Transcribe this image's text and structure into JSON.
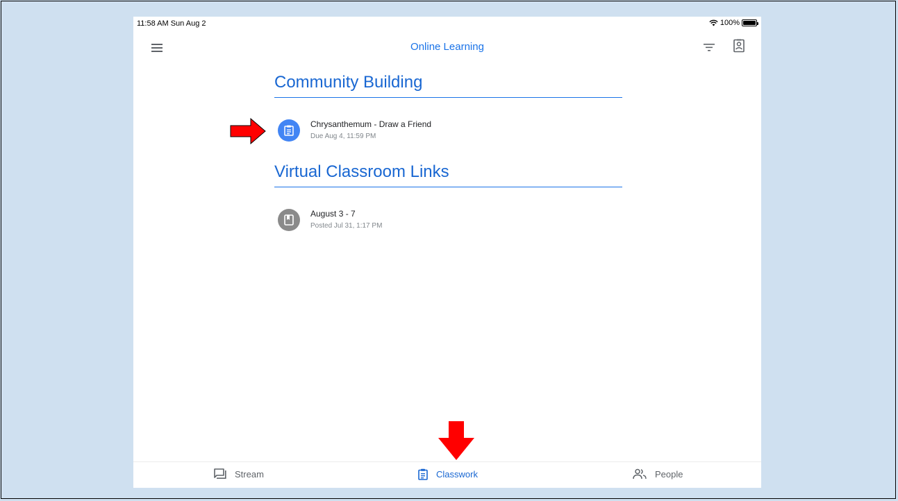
{
  "status_bar": {
    "time": "11:58 AM  Sun Aug 2",
    "battery": "100%"
  },
  "header": {
    "title": "Online Learning"
  },
  "topics": [
    {
      "title": "Community Building",
      "items": [
        {
          "title": "Chrysanthemum - Draw a Friend",
          "subtitle": "Due Aug 4, 11:59 PM",
          "icon": "assignment-icon"
        }
      ]
    },
    {
      "title": "Virtual Classroom Links",
      "items": [
        {
          "title": "August 3 - 7",
          "subtitle": "Posted Jul 31, 1:17 PM",
          "icon": "material-icon"
        }
      ]
    }
  ],
  "bottom_nav": [
    {
      "label": "Stream",
      "icon": "stream-icon",
      "active": false
    },
    {
      "label": "Classwork",
      "icon": "classwork-icon",
      "active": true
    },
    {
      "label": "People",
      "icon": "people-icon",
      "active": false
    }
  ],
  "colors": {
    "accent": "#1a73e8",
    "annotation_arrow": "#ff0000",
    "background": "#cfe0f0",
    "inactive_icon": "#8a8a8a"
  }
}
